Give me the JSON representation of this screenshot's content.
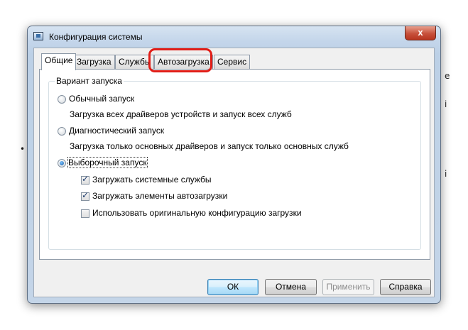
{
  "window": {
    "title": "Конфигурация системы",
    "close_label": "x"
  },
  "tabs": [
    {
      "label": "Общие",
      "active": true
    },
    {
      "label": "Загрузка",
      "active": false
    },
    {
      "label": "Службы",
      "active": false
    },
    {
      "label": "Автозагрузка",
      "active": false
    },
    {
      "label": "Сервис",
      "active": false
    }
  ],
  "startup_group": {
    "legend": "Вариант запуска",
    "normal": {
      "label": "Обычный запуск",
      "description": "Загрузка всех драйверов устройств и запуск всех служб",
      "selected": false
    },
    "diagnostic": {
      "label": "Диагностический запуск",
      "description": "Загрузка только основных драйверов и запуск только основных служб",
      "selected": false
    },
    "selective": {
      "label": "Выборочный запуск",
      "selected": true
    },
    "options": [
      {
        "label": "Загружать системные службы",
        "checked": true
      },
      {
        "label": "Загружать элементы автозагрузки",
        "checked": true
      },
      {
        "label": "Использовать оригинальную конфигурацию загрузки",
        "checked": false
      }
    ]
  },
  "buttons": {
    "ok": "ОК",
    "cancel": "Отмена",
    "apply": "Применить",
    "help": "Справка"
  },
  "colors": {
    "highlight": "#e11d17",
    "accent": "#3c7fb1"
  },
  "icons": {
    "app": "msconfig-icon",
    "close": "close-icon"
  }
}
